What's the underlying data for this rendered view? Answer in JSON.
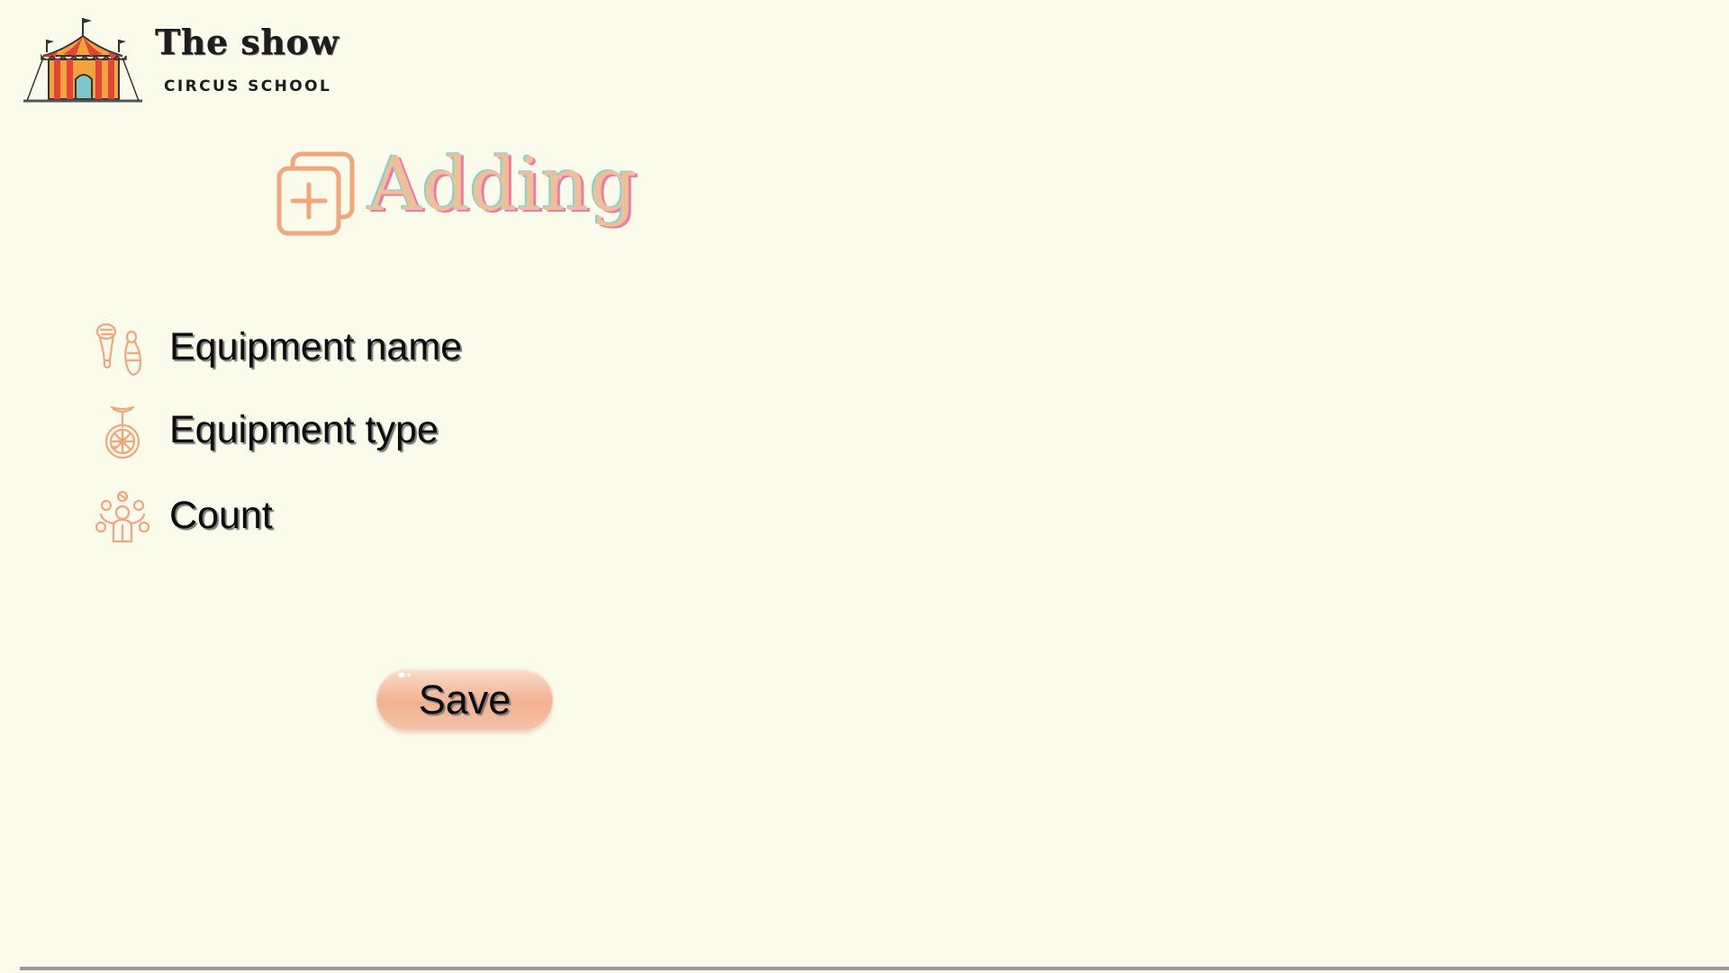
{
  "logo": {
    "title": "The show",
    "subtitle": "CIRCUS SCHOOL",
    "icon": "circus-tent-icon"
  },
  "heading": {
    "text": "Adding",
    "icon": "add-copy-icon"
  },
  "form": {
    "fields": [
      {
        "label": "Equipment name",
        "icon": "juggling-clubs-icon"
      },
      {
        "label": "Equipment type",
        "icon": "unicycle-icon"
      },
      {
        "label": "Count",
        "icon": "juggler-icon"
      }
    ]
  },
  "actions": {
    "save_label": "Save"
  },
  "colors": {
    "background": "#fbfbec",
    "accent": "#f1a67e",
    "heading_fill": "#eec09a",
    "heading_shadow_teal": "#7fd4cf",
    "heading_shadow_pink": "#ef7aa6",
    "button_fill": "#f2b191",
    "divider": "#9a9a9a"
  }
}
